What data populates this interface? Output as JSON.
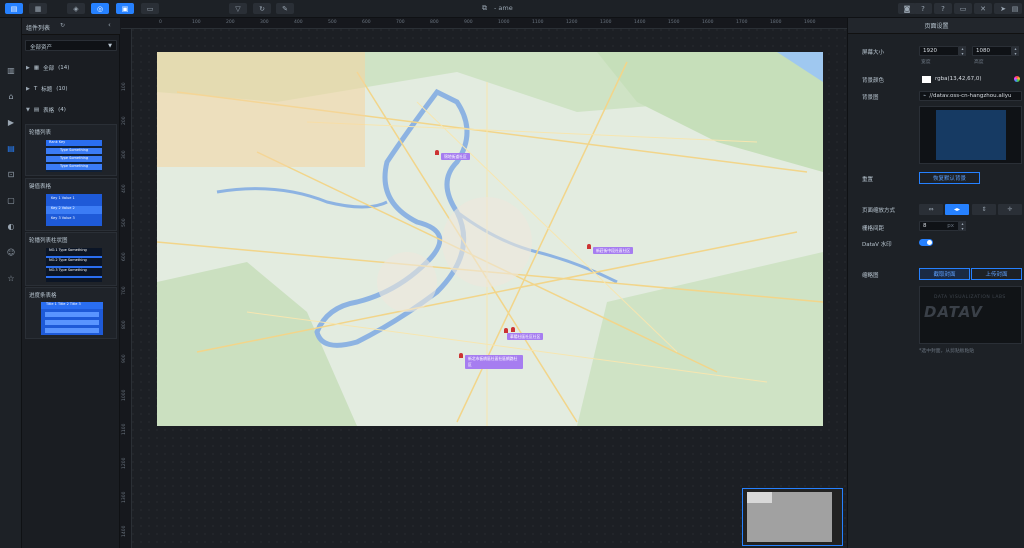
{
  "topbar": {
    "doc_title": "- ame",
    "left_buttons": [
      "layers-icon",
      "component-icon",
      "settings-icon",
      "panel-icon",
      "layout-icon",
      "list-icon",
      "save-icon"
    ],
    "tools": [
      "filter-icon",
      "refresh-icon",
      "brush-icon"
    ],
    "right_buttons": [
      "camera-icon",
      "help-icon",
      "screen-icon",
      "cross-icon",
      "send-icon",
      "preview-icon"
    ]
  },
  "components_panel": {
    "title": "组件列表",
    "select_value": "全部资产",
    "categories": [
      {
        "label": "全部",
        "count": "(14)"
      },
      {
        "label": "标题",
        "count": "(10)"
      },
      {
        "label": "表格",
        "count": "(4)"
      }
    ],
    "cards": [
      {
        "title": "轮播列表",
        "rows": [
          "Rank  Key",
          "Type Something",
          "Type Something",
          "Type Something"
        ]
      },
      {
        "title": "键值表格",
        "rows": [
          "Key 1  Value 1",
          "Key 2  Value 2",
          "Key 3  Value 3"
        ]
      },
      {
        "title": "轮播列表柱状图",
        "rows": [
          "NO.1  Type Something",
          "NO.2  Type Something",
          "NO.3  Type Something"
        ]
      },
      {
        "title": "进度条表格",
        "rows": [
          "Title 1  Title 2  Title 3"
        ]
      }
    ]
  },
  "rail_icons": [
    "chart-icon",
    "map-icon",
    "media-icon",
    "table-icon",
    "relation-icon",
    "doc-icon",
    "interact-icon",
    "other-icon",
    "favorite-icon"
  ],
  "ruler": {
    "top": [
      "0",
      "100",
      "200",
      "300",
      "400",
      "500",
      "600",
      "700",
      "800",
      "900",
      "1000",
      "1100",
      "1200",
      "1300",
      "1400",
      "1500",
      "1600",
      "1700",
      "1800",
      "1900"
    ],
    "left": [
      "100",
      "200",
      "300",
      "400",
      "500",
      "600",
      "700",
      "800",
      "900",
      "1000",
      "1100",
      "1200",
      "1300",
      "1400"
    ]
  },
  "map": {
    "markers": [
      {
        "label": "锦地街道社区"
      },
      {
        "label": "新莊街中段社區社区"
      },
      {
        "label": "華陽社區社区社区"
      },
      {
        "label": "新北市板橋區社區社區網路社区"
      }
    ]
  },
  "settings": {
    "title": "页面设置",
    "screen_size_label": "屏幕大小",
    "width_value": "1920",
    "height_value": "1080",
    "width_sub": "宽度",
    "height_sub": "高度",
    "bg_color_label": "背景颜色",
    "bg_color_value": "rgba(13,42,67,0)",
    "bg_image_label": "背景图",
    "bg_image_value": "//datav.oss-cn-hangzhou.aliyu",
    "reset_label": "重置",
    "reset_button": "恢复默认背景",
    "zoom_label": "页面缩放方式",
    "grid_label": "栅格间距",
    "grid_value": "8",
    "grid_unit": "px",
    "watermark_label": "DataV 水印",
    "thumb_label": "缩略图",
    "capture_button": "截取封面",
    "upload_button": "上传封面",
    "thumb_note": "*选中封面，从剪贴板粘贴",
    "logo_text": "DATAV",
    "logo_sub": "DATA VISUALIZATION LABS",
    "accent": "#2681ff"
  }
}
